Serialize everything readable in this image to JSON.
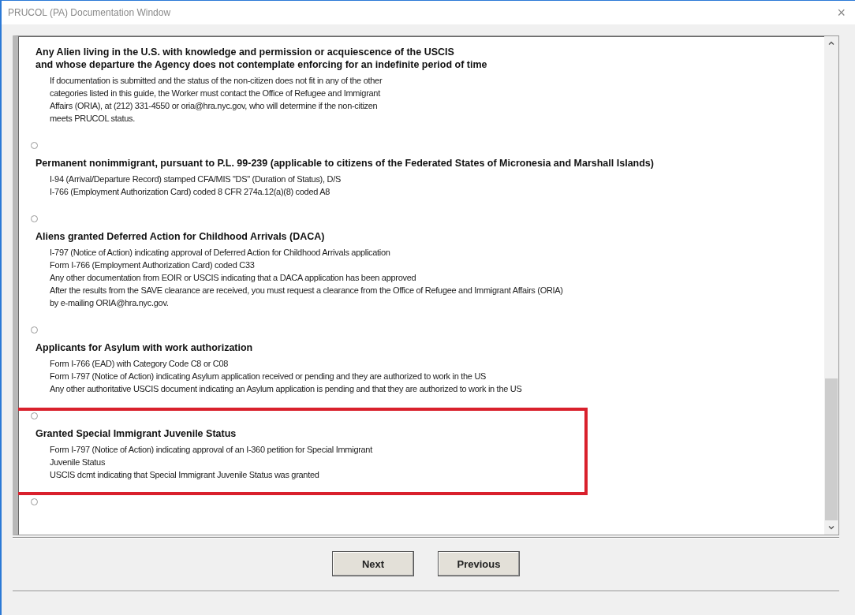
{
  "window": {
    "title": "PRUCOL (PA)  Documentation Window",
    "close": "×"
  },
  "options": [
    {
      "highlighted": false,
      "title_lines": [
        "Any Alien living in the U.S. with knowledge and permission or acquiescence of the USCIS",
        "and whose departure the Agency does not contemplate enforcing for an indefinite period of time"
      ],
      "lines": [
        "If documentation is submitted and the status of the non-citizen does not fit in any of the other",
        "categories listed in this guide, the Worker must contact the Office of Refugee and Immigrant",
        "Affairs (ORIA), at (212) 331-4550 or oria@hra.nyc.gov, who will determine if the non-citizen",
        "meets PRUCOL status."
      ]
    },
    {
      "selected": false,
      "highlighted": false,
      "title_lines": [
        "Permanent nonimmigrant, pursuant to P.L. 99-239 (applicable to citizens of the Federated States of Micronesia and Marshall Islands)"
      ],
      "lines": [
        "I-94 (Arrival/Departure Record) stamped CFA/MIS \"DS\" (Duration of Status), D/S",
        "I-766 (Employment Authorization Card) coded 8 CFR 274a.12(a)(8) coded A8"
      ]
    },
    {
      "selected": false,
      "highlighted": false,
      "title_lines": [
        "Aliens granted Deferred Action for Childhood Arrivals (DACA)"
      ],
      "lines": [
        "I-797 (Notice of Action) indicating approval of Deferred Action for Childhood Arrivals application",
        "Form I-766 (Employment Authorization Card) coded C33",
        "Any other documentation from EOIR or USCIS indicating that a DACA application has been approved",
        "After the results from the SAVE clearance are received, you must request a clearance from the Office of Refugee and Immigrant Affairs (ORIA)",
        "by e-mailing ORIA@hra.nyc.gov."
      ]
    },
    {
      "selected": false,
      "highlighted": false,
      "title_lines": [
        "Applicants for Asylum with work authorization"
      ],
      "lines": [
        "Form I-766 (EAD) with Category Code C8 or C08",
        "Form I-797 (Notice of Action) indicating Asylum application received or pending and they are authorized to work in the US",
        "Any other authoritative USCIS document indicating an Asylum application is pending and that they are authorized to work in the US"
      ]
    },
    {
      "selected": false,
      "highlighted": true,
      "title_lines": [
        "Granted Special Immigrant Juvenile Status"
      ],
      "lines": [
        "Form I-797 (Notice of Action) indicating approval of an I-360 petition for Special Immigrant",
        "Juvenile Status",
        "USCIS dcmt indicating that Special Immigrant Juvenile Status was granted"
      ]
    },
    {
      "selected": false,
      "highlighted": false
    }
  ],
  "buttons": [
    "Next",
    "Previous"
  ]
}
